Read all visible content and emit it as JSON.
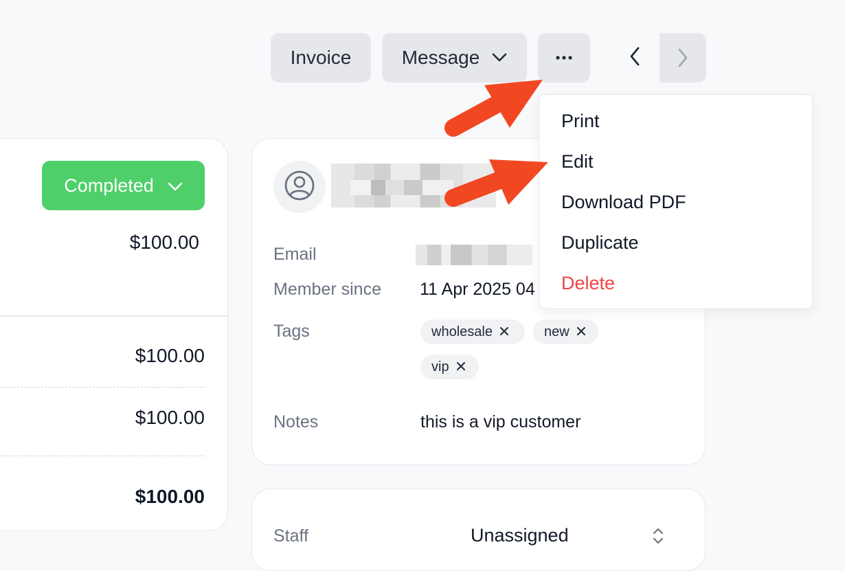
{
  "toolbar": {
    "invoice_label": "Invoice",
    "message_label": "Message",
    "more_icon": "ellipsis-icon",
    "prev_icon": "chevron-left-icon",
    "next_icon": "chevron-right-icon"
  },
  "order": {
    "status": "Completed",
    "total_top": "$100.00",
    "lines": [
      "$100.00",
      "$100.00"
    ],
    "grand_total": "$100.00"
  },
  "customer": {
    "avatar_icon": "user-circle-icon",
    "email_label": "Email",
    "member_since_label": "Member since",
    "member_since_value": "11 Apr 2025 04",
    "tags_label": "Tags",
    "tags": [
      "wholesale",
      "new",
      "vip"
    ],
    "notes_label": "Notes",
    "notes_value": "this is a vip customer"
  },
  "assignment": {
    "staff_label": "Staff",
    "staff_value": "Unassigned"
  },
  "menu": {
    "items": [
      "Print",
      "Edit",
      "Download PDF",
      "Duplicate",
      "Delete"
    ]
  },
  "colors": {
    "completed": "#4fcf6a",
    "delete": "#ef4444",
    "annotation": "#f24822"
  }
}
